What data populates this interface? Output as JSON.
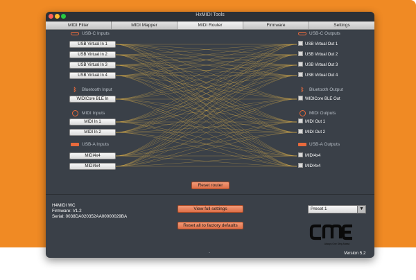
{
  "window": {
    "title": "HxMIDI Tools"
  },
  "tabs": [
    "MIDI Filter",
    "MIDI Mapper",
    "MIDI Router",
    "Firmware",
    "Settings"
  ],
  "active_tab": "MIDI Router",
  "inputs": {
    "usb_c": {
      "header": "USB-C Inputs",
      "ports": [
        "USB Virtual In 1",
        "USB Virtual In 2",
        "USB Virtual In 3",
        "USB Virtual In 4"
      ]
    },
    "bluetooth": {
      "header": "Bluetooth Input",
      "ports": [
        "WIDICore BLE In"
      ]
    },
    "midi": {
      "header": "MIDI Inputs",
      "ports": [
        "MIDI In 1",
        "MIDI In 2"
      ]
    },
    "usb_a": {
      "header": "USB-A Inputs",
      "ports": [
        "MIDI4x4",
        "MIDI4x4"
      ]
    }
  },
  "outputs": {
    "usb_c": {
      "header": "USB-C Outputs",
      "ports": [
        "USB Virtual Out 1",
        "USB Virtual Out 2",
        "USB Virtual Out 3",
        "USB Virtual Out 4"
      ]
    },
    "bluetooth": {
      "header": "Bluetooth Output",
      "ports": [
        "WIDICore BLE Out"
      ]
    },
    "midi": {
      "header": "MIDI Outputs",
      "ports": [
        "MIDI Out 1",
        "MIDI Out 2"
      ]
    },
    "usb_a": {
      "header": "USB-A Outputs",
      "ports": [
        "MIDI4x4",
        "MIDI4x4"
      ]
    }
  },
  "buttons": {
    "reset_router": "Reset router",
    "view_settings": "View full settings",
    "factory_reset": "Reset all to factory defaults"
  },
  "device": {
    "name": "H4MIDI WC",
    "firmware": "Firmware: V1.2",
    "serial": "Serial: 0038DA020352AA00000029BA"
  },
  "preset": {
    "selected": "Preset 1"
  },
  "logo": {
    "text": "CME",
    "tagline": "Always One Step Ahead"
  },
  "footer": {
    "dash": "-",
    "version": "Version 5.2"
  },
  "colors": {
    "accent": "#e86a3c",
    "route_line": "#c9a34a",
    "window_bg": "#3a4048",
    "page_bg": "#f08a24"
  }
}
